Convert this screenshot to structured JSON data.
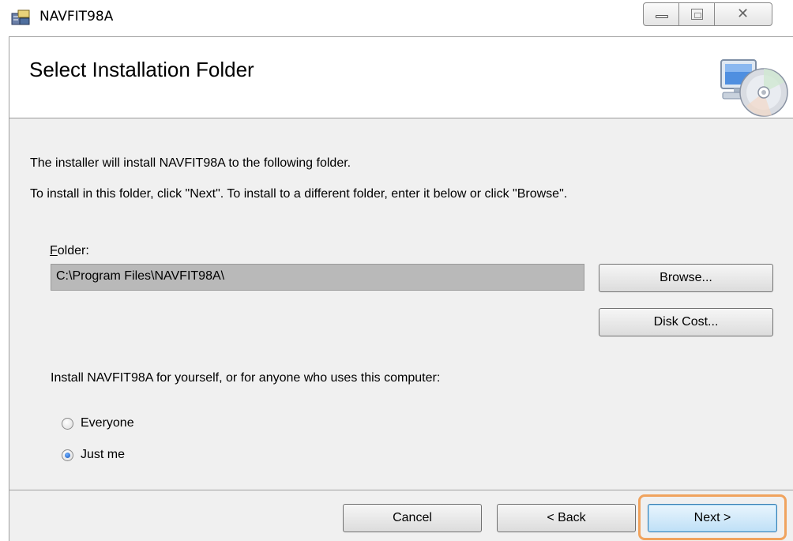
{
  "window": {
    "title": "NAVFIT98A",
    "icon": "installer-icon"
  },
  "banner": {
    "title": "Select Installation Folder",
    "icon": "computer-cd-icon"
  },
  "body": {
    "line1": "The installer will install NAVFIT98A to the following folder.",
    "line2": "To install in this folder, click \"Next\". To install to a different folder, enter it below or click \"Browse\".",
    "folder_label_mnemonic": "F",
    "folder_label_rest": "older:",
    "folder_value": "C:\\Program Files\\NAVFIT98A\\",
    "browse_label": "Browse...",
    "disk_cost_label": "Disk Cost...",
    "install_for_text": "Install NAVFIT98A for yourself, or for anyone who uses this computer:",
    "radio_options": [
      {
        "label": "Everyone",
        "checked": false
      },
      {
        "label": "Just me",
        "checked": true
      }
    ]
  },
  "footer": {
    "cancel_label": "Cancel",
    "back_label": "< Back",
    "next_label": "Next >",
    "highlight_color": "#f0a35e"
  }
}
